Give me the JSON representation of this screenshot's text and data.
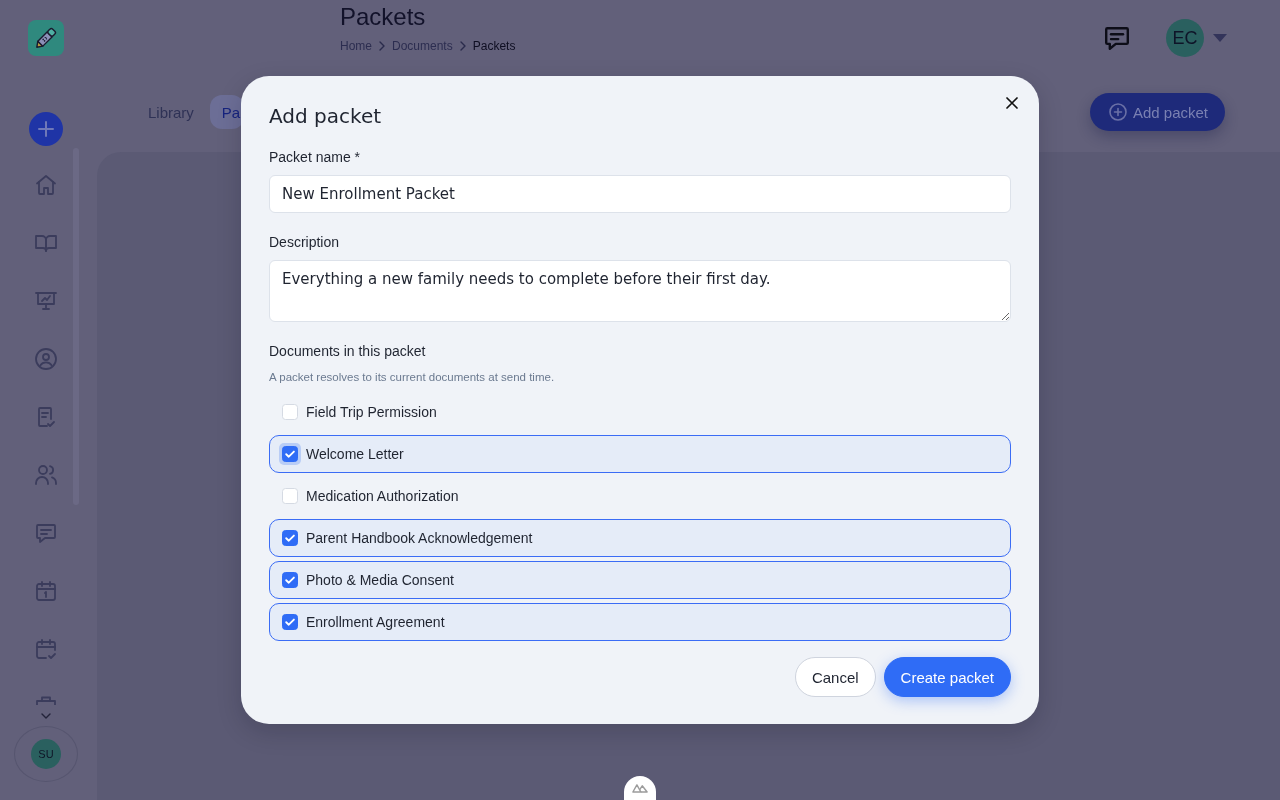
{
  "header": {
    "title": "Packets",
    "breadcrumbs": [
      {
        "label": "Home",
        "current": false
      },
      {
        "label": "Documents",
        "current": false
      },
      {
        "label": "Packets",
        "current": true
      }
    ],
    "avatar_initials": "EC"
  },
  "tabs": [
    {
      "label": "Library",
      "selected": false
    },
    {
      "label": "Pa",
      "selected": true
    }
  ],
  "add_button": "Add packet",
  "sidebar": {
    "user_initials": "SU"
  },
  "dialog": {
    "title": "Add packet",
    "fields": [
      {
        "kind": "input",
        "label": "Packet name *",
        "value": "New Enrollment Packet"
      },
      {
        "kind": "textarea",
        "label": "Description",
        "value": "Everything a new family needs to complete before their first day."
      }
    ],
    "documents": {
      "label": "Documents in this packet",
      "hint": "A packet resolves to its current documents at send time.",
      "items": [
        {
          "name": "Field Trip Permission",
          "checked": false,
          "focused": false
        },
        {
          "name": "Welcome Letter",
          "checked": true,
          "focused": true
        },
        {
          "name": "Medication Authorization",
          "checked": false,
          "focused": false
        },
        {
          "name": "Parent Handbook Acknowledgement",
          "checked": true,
          "focused": false
        },
        {
          "name": "Photo & Media Consent",
          "checked": true,
          "focused": false
        },
        {
          "name": "Enrollment Agreement",
          "checked": true,
          "focused": false
        }
      ]
    },
    "buttons": [
      {
        "kind": "secondary",
        "label": "Cancel"
      },
      {
        "kind": "primary",
        "label": "Create packet"
      }
    ]
  }
}
